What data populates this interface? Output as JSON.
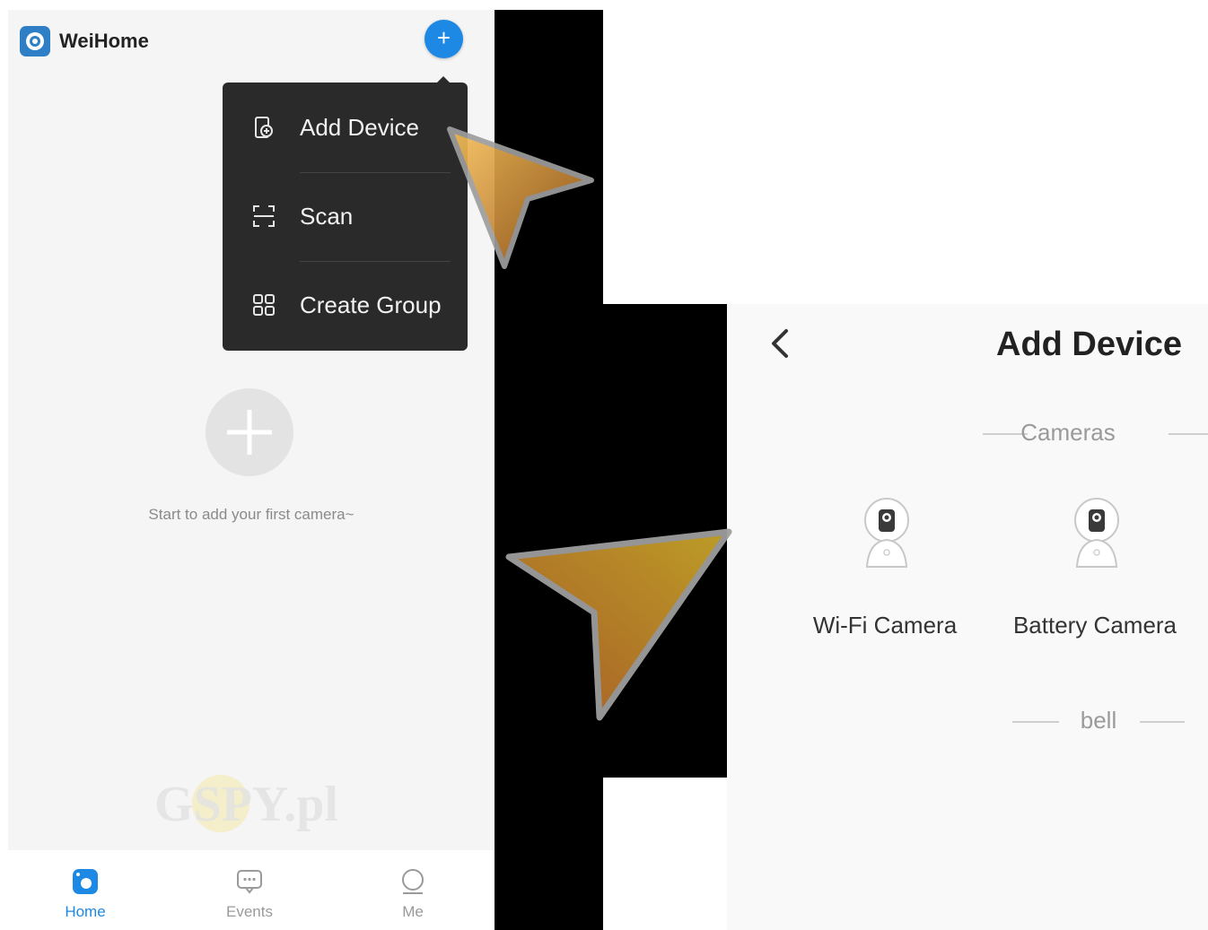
{
  "left_screen": {
    "app_title": "WeiHome",
    "menu": {
      "items": [
        {
          "label": "Add Device",
          "icon": "add-device-icon"
        },
        {
          "label": "Scan",
          "icon": "scan-icon"
        },
        {
          "label": "Create Group",
          "icon": "group-icon"
        }
      ]
    },
    "empty_state": {
      "text": "Start to add your first camera~"
    },
    "watermark_text": "GSPY.pl",
    "bottom_nav": {
      "items": [
        {
          "label": "Home",
          "active": true,
          "icon": "home-camera-icon"
        },
        {
          "label": "Events",
          "active": false,
          "icon": "events-chat-icon"
        },
        {
          "label": "Me",
          "active": false,
          "icon": "profile-icon"
        }
      ]
    }
  },
  "right_screen": {
    "title": "Add Device",
    "sections": [
      {
        "heading": "Cameras",
        "devices": [
          {
            "label": "Wi-Fi Camera",
            "icon": "wifi-camera-icon"
          },
          {
            "label": "Battery Camera",
            "icon": "battery-camera-icon"
          }
        ]
      },
      {
        "heading": "bell",
        "devices": []
      }
    ]
  },
  "colors": {
    "accent": "#1e88e5",
    "menu_bg": "#2a2a2a",
    "arrow_fill": "#b5651d",
    "arrow_stroke": "#9e9e9e"
  }
}
